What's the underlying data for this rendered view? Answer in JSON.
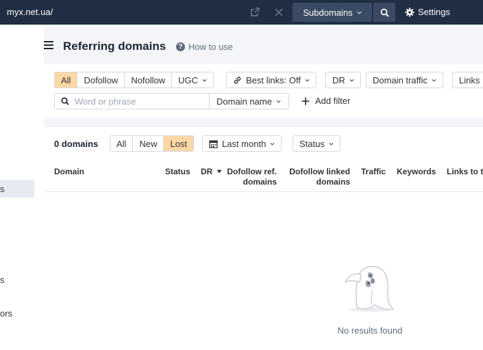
{
  "topbar": {
    "url": "myx.net.ua/",
    "mode": "Subdomains",
    "settings_label": "Settings"
  },
  "sidebar": {
    "items": [
      "",
      "s",
      "s",
      "ors"
    ]
  },
  "page": {
    "title": "Referring domains",
    "how_to_use": "How to use"
  },
  "filters": {
    "link_types": [
      "All",
      "Dofollow",
      "Nofollow",
      "UGC"
    ],
    "best_links": "Best links: Off",
    "dr": "DR",
    "domain_traffic": "Domain traffic",
    "links": "Links",
    "search_placeholder": "Word or phrase",
    "search_value": "",
    "search_scope": "Domain name",
    "add_filter": "Add filter"
  },
  "results": {
    "count": "0 domains",
    "status_tabs": [
      "All",
      "New",
      "Lost"
    ],
    "period": "Last month",
    "status_filter": "Status",
    "columns": {
      "domain": "Domain",
      "status": "Status",
      "dr": "DR",
      "dofollow_ref_1": "Dofollow ref.",
      "dofollow_ref_2": "domains",
      "dofollow_linked_1": "Dofollow linked",
      "dofollow_linked_2": "domains",
      "traffic": "Traffic",
      "keywords": "Keywords",
      "links_to": "Links to t"
    },
    "empty_message": "No results found"
  },
  "colors": {
    "topbar": "#202e44",
    "active_segment": "#fbd7a6",
    "page_bg": "#f4f5f8"
  }
}
